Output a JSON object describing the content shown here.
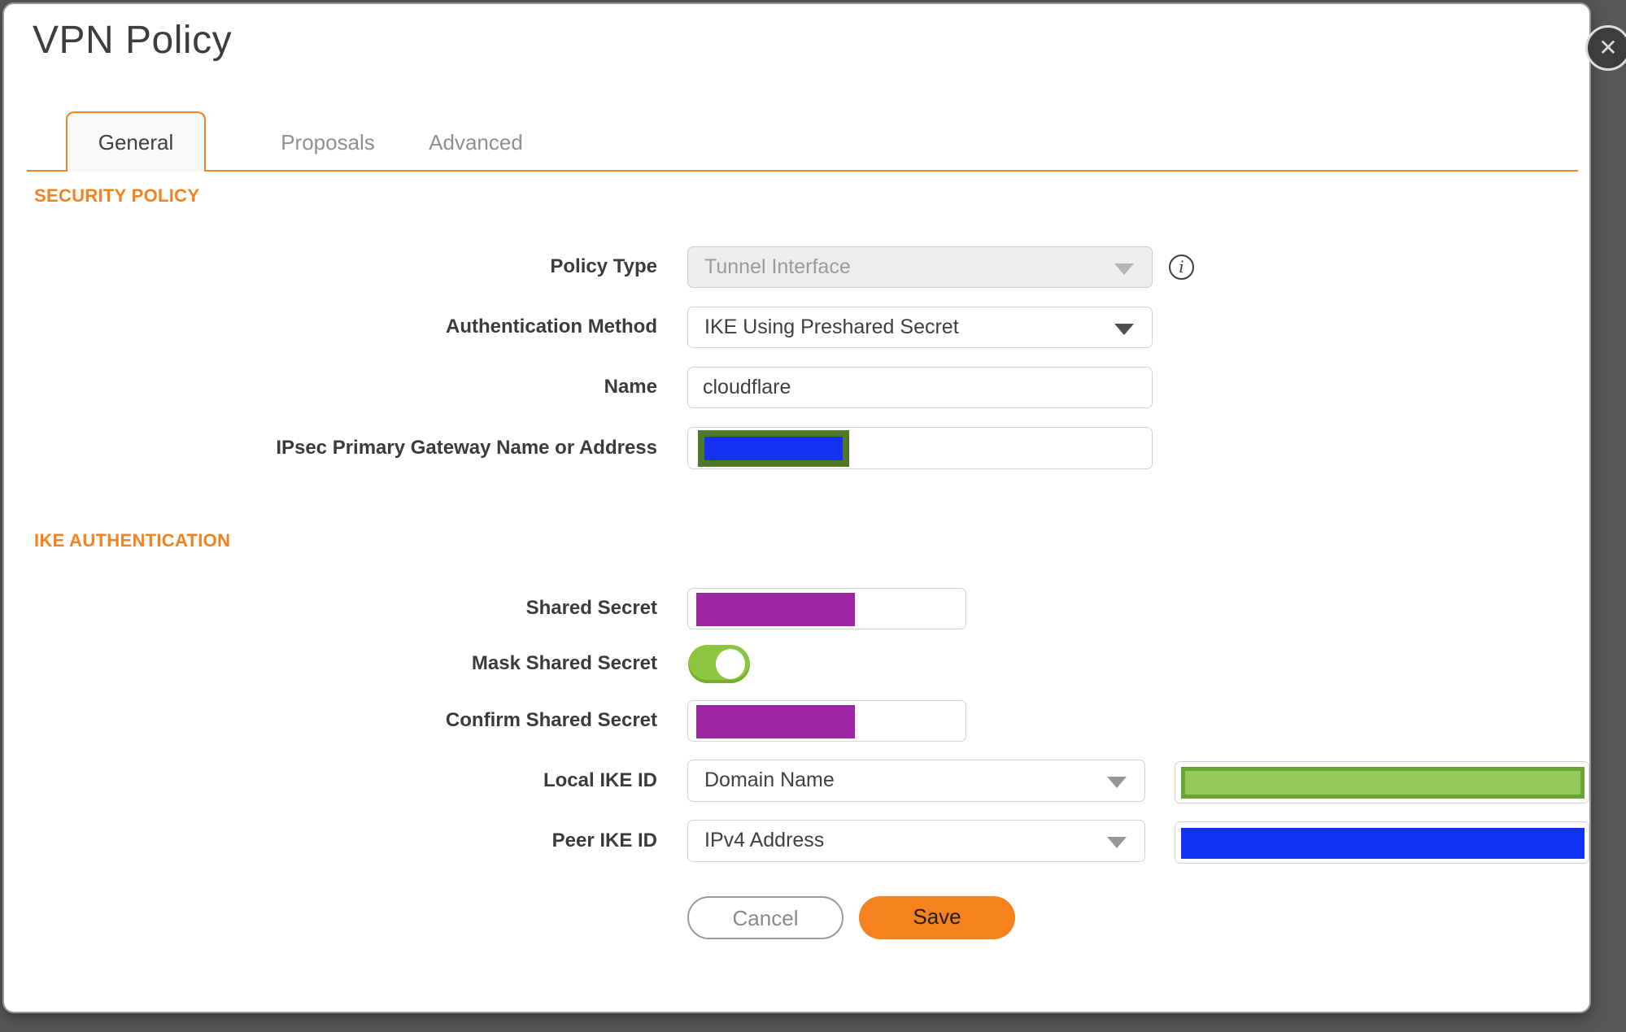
{
  "dialog": {
    "title": "VPN Policy"
  },
  "icons": {
    "close": "✕",
    "info": "i"
  },
  "tabs": [
    {
      "label": "General",
      "active": true
    },
    {
      "label": "Proposals",
      "active": false
    },
    {
      "label": "Advanced",
      "active": false
    }
  ],
  "sections": {
    "security_policy": "SECURITY POLICY",
    "ike_authentication": "IKE AUTHENTICATION"
  },
  "fields": {
    "policy_type": {
      "label": "Policy Type",
      "value": "Tunnel Interface",
      "state": "disabled"
    },
    "authentication_method": {
      "label": "Authentication Method",
      "value": "IKE Using Preshared Secret"
    },
    "name": {
      "label": "Name",
      "value": "cloudflare"
    },
    "gateway": {
      "label": "IPsec Primary Gateway Name or Address",
      "value": ""
    },
    "shared_secret": {
      "label": "Shared Secret",
      "value": ""
    },
    "mask_shared_secret": {
      "label": "Mask Shared Secret",
      "state": "on"
    },
    "confirm_shared_secret": {
      "label": "Confirm Shared Secret",
      "value": ""
    },
    "local_ike_id": {
      "label": "Local IKE ID",
      "value": "Domain Name"
    },
    "peer_ike_id": {
      "label": "Peer IKE ID",
      "value": "IPv4 Address"
    }
  },
  "buttons": {
    "cancel": "Cancel",
    "save": "Save"
  },
  "colors": {
    "accent_orange": "#f5821f",
    "redaction_purple": "#9d27a3",
    "redaction_blue": "#1532f4",
    "redaction_green_fill": "#94ca58",
    "redaction_green_border": "#68a436",
    "gateway_redaction_border": "#507728",
    "toggle_green": "#8cc640"
  }
}
